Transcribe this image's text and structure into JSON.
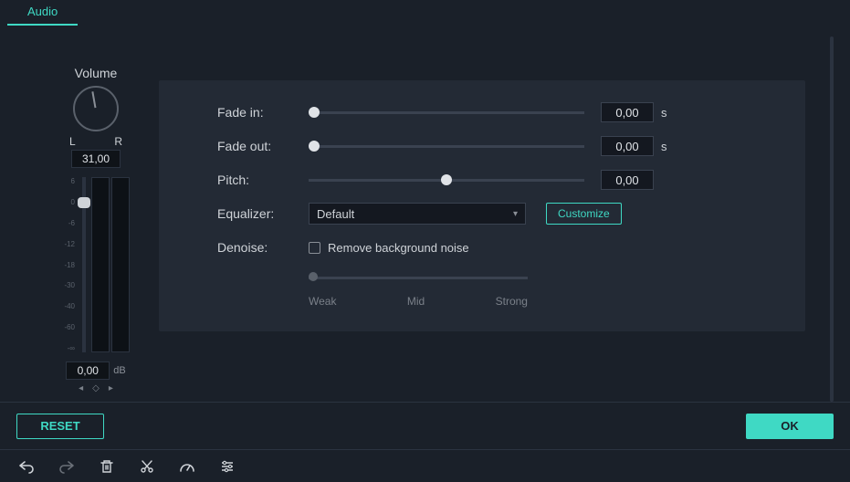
{
  "tab": {
    "label": "Audio"
  },
  "volume": {
    "title": "Volume",
    "left_label": "L",
    "right_label": "R",
    "pan_value": "31,00",
    "db_value": "0,00",
    "db_unit": "dB",
    "scale": [
      "6",
      "0",
      "-6",
      "-12",
      "-18",
      "-30",
      "-40",
      "-60",
      "-∞"
    ]
  },
  "settings": {
    "fade_in": {
      "label": "Fade in:",
      "value": "0,00",
      "unit": "s",
      "pos": 0
    },
    "fade_out": {
      "label": "Fade out:",
      "value": "0,00",
      "unit": "s",
      "pos": 0
    },
    "pitch": {
      "label": "Pitch:",
      "value": "0,00",
      "pos": 50
    },
    "equalizer": {
      "label": "Equalizer:",
      "value": "Default",
      "customize": "Customize"
    },
    "denoise": {
      "label": "Denoise:",
      "checkbox_label": "Remove background noise",
      "weak": "Weak",
      "mid": "Mid",
      "strong": "Strong"
    }
  },
  "footer": {
    "reset": "RESET",
    "ok": "OK"
  }
}
